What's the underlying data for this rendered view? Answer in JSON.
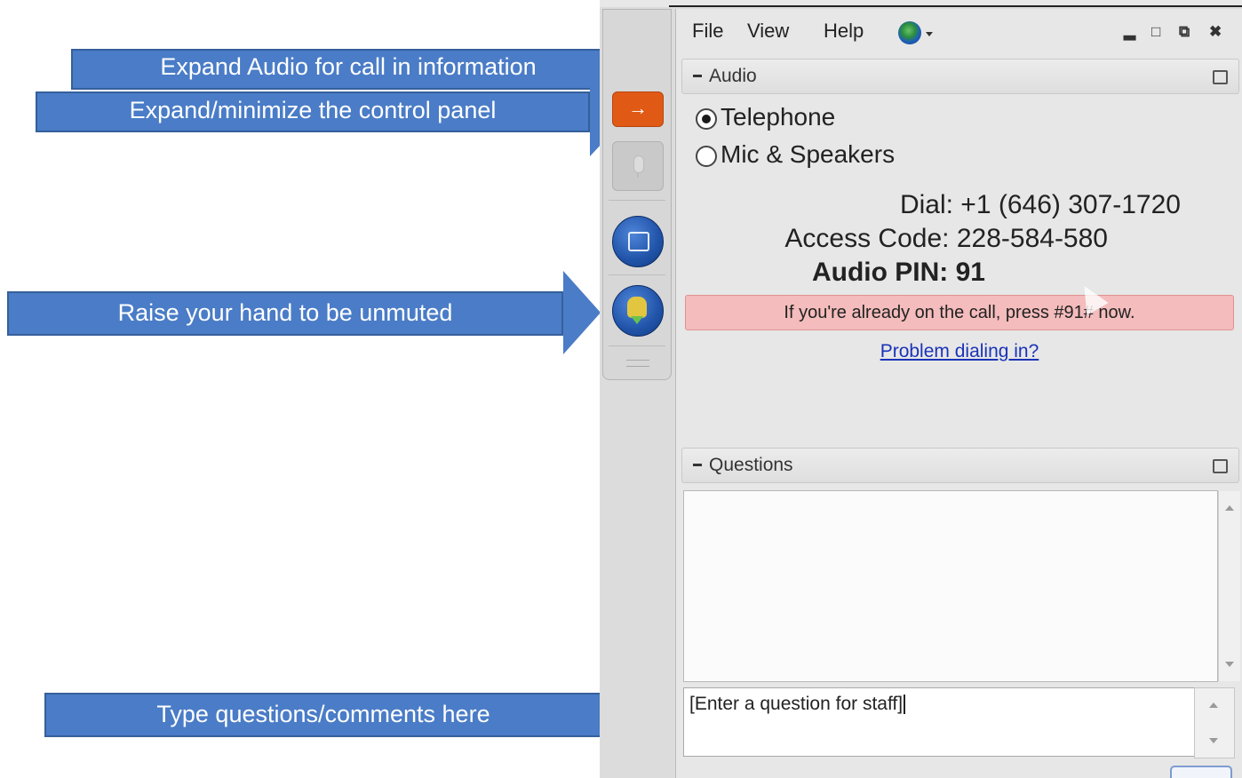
{
  "callouts": {
    "audio": "Expand Audio for call in information",
    "panel": "Expand/minimize the control panel",
    "hand": "Raise your hand to be unmuted",
    "questions": "Type questions/comments here"
  },
  "menu": {
    "file": "File",
    "view": "View",
    "help": "Help"
  },
  "window_controls": {
    "minimize": "▂",
    "restore": "□",
    "popout": "⧉",
    "close": "✖"
  },
  "side_panel": {
    "expand_glyph": "→"
  },
  "audio": {
    "title": "Audio",
    "options": [
      {
        "label": "Telephone",
        "selected": true
      },
      {
        "label": "Mic & Speakers",
        "selected": false
      }
    ],
    "dial_label": "Dial:",
    "dial_value": "+1 (646) 307-1720",
    "access_label": "Access Code:",
    "access_value": "228-584-580",
    "pin_label": "Audio PIN:",
    "pin_value": "91",
    "pin_note": "If you're already on the call, press #91# now.",
    "problem_link": "Problem dialing in?"
  },
  "questions": {
    "title": "Questions",
    "input_value": "[Enter a question for staff]"
  },
  "colors": {
    "callout_fill": "#4a7cc7",
    "accent_orange": "#e05a16",
    "pin_note_bg": "#f4bcbc",
    "link": "#1a33b8"
  },
  "icons": [
    "globe-icon",
    "microphone-icon",
    "screen-share-icon",
    "raise-hand-icon",
    "popout-icon",
    "collapse-icon",
    "mouse-cursor-icon"
  ]
}
